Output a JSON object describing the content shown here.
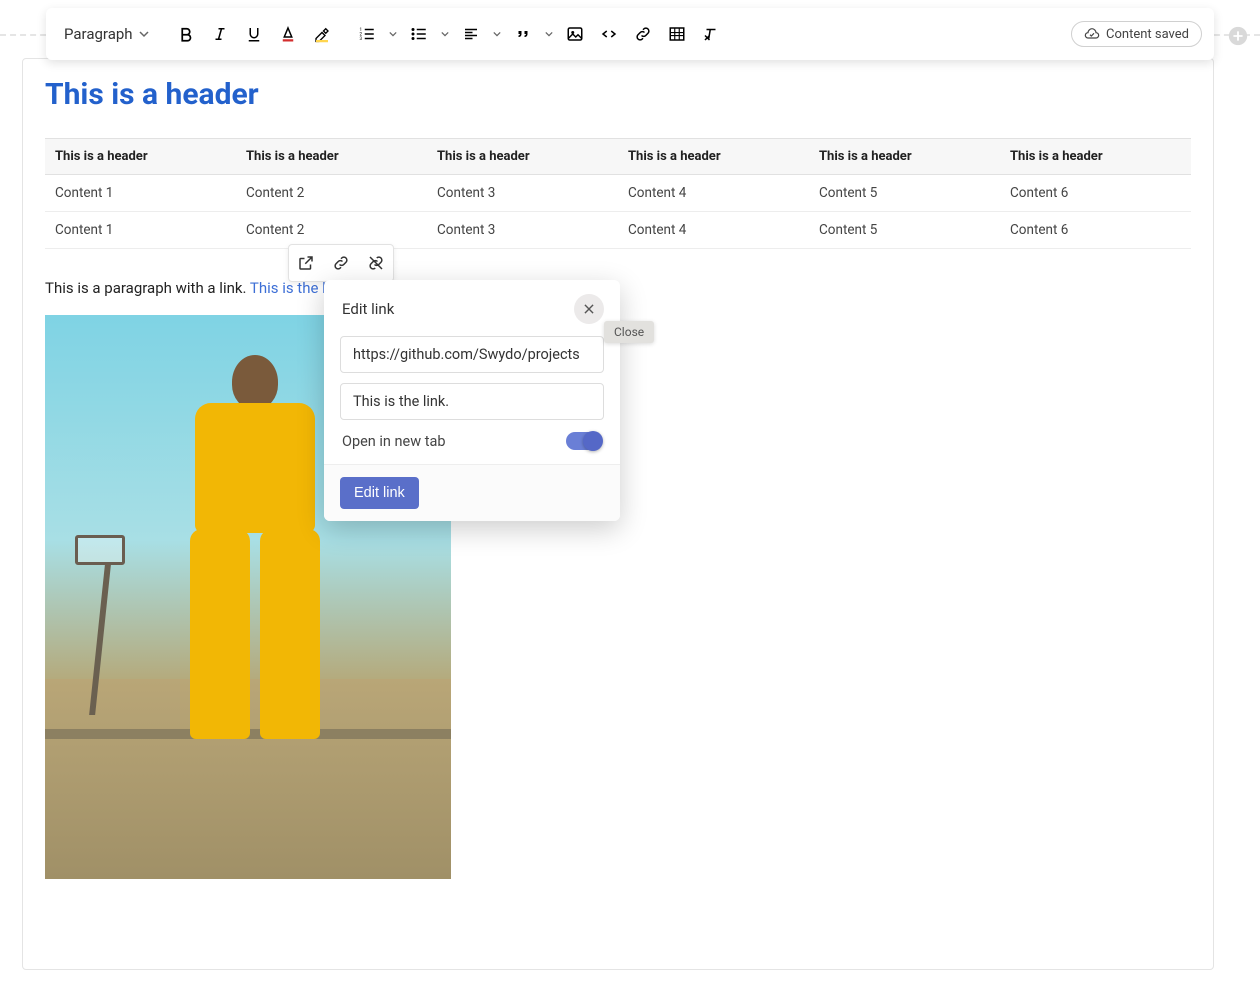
{
  "toolbar": {
    "block_type": "Paragraph",
    "saved_label": "Content saved"
  },
  "document": {
    "header": "This is a header",
    "table": {
      "headers": [
        "This is a header",
        "This is a header",
        "This is a header",
        "This is a header",
        "This is a header",
        "This is a header"
      ],
      "rows": [
        [
          "Content 1",
          "Content 2",
          "Content 3",
          "Content 4",
          "Content 5",
          "Content 6"
        ],
        [
          "Content 1",
          "Content 2",
          "Content 3",
          "Content 4",
          "Content 5",
          "Content 6"
        ]
      ]
    },
    "paragraph_prefix": "This is a paragraph with a link. ",
    "link_text": "This is the link."
  },
  "link_modal": {
    "title": "Edit link",
    "url_value": "https://github.com/Swydo/projects",
    "text_value": "This is the link.",
    "new_tab_label": "Open in new tab",
    "submit_label": "Edit link",
    "close_tooltip": "Close"
  }
}
